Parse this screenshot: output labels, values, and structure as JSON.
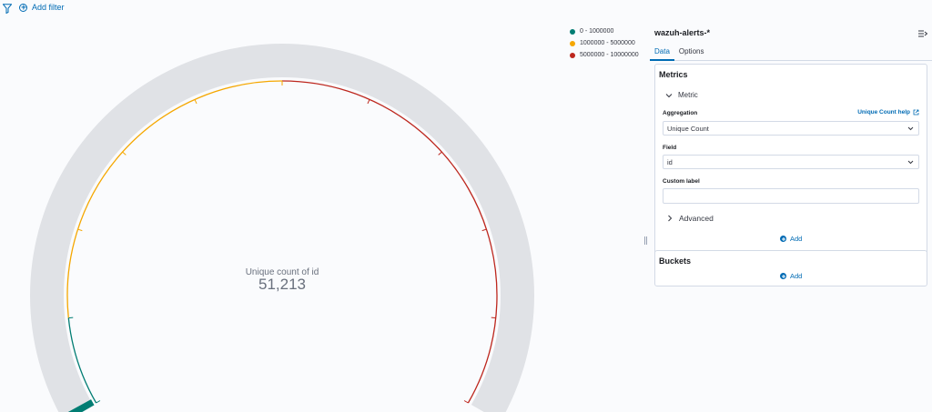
{
  "filter_bar": {
    "add_filter_label": "Add filter",
    "filter_icon": "filter-icon",
    "add_icon": "plus-circle-icon"
  },
  "gauge": {
    "metric_label": "Unique count of id",
    "metric_value": "51,213",
    "value": 51213,
    "range_min": 0,
    "range_max": 10000000,
    "background_color": "#e0e2e6"
  },
  "chart_data": {
    "type": "gauge",
    "series": [
      {
        "name": "Unique count of id",
        "values": [
          51213
        ]
      }
    ],
    "ranges": [
      {
        "label": "0 - 1000000",
        "from": 0,
        "to": 1000000,
        "color": "#017d73"
      },
      {
        "label": "1000000 - 5000000",
        "from": 1000000,
        "to": 5000000,
        "color": "#f5a700"
      },
      {
        "label": "5000000 - 10000000",
        "from": 5000000,
        "to": 10000000,
        "color": "#bd271e"
      }
    ],
    "ylim": [
      0,
      10000000
    ]
  },
  "legend": [
    {
      "label": "0 - 1000000",
      "color": "#017d73"
    },
    {
      "label": "1000000 - 5000000",
      "color": "#f5a700"
    },
    {
      "label": "5000000 - 10000000",
      "color": "#bd271e"
    }
  ],
  "sidebar": {
    "title": "wazuh-alerts-*",
    "collapse_icon": "collapse-panel-icon",
    "tabs": [
      {
        "label": "Data",
        "active": true
      },
      {
        "label": "Options",
        "active": false
      }
    ],
    "metrics": {
      "title": "Metrics",
      "metric_toggle": "Metric",
      "aggregation_label": "Aggregation",
      "aggregation_help": "Unique Count help",
      "aggregation_value": "Unique Count",
      "field_label": "Field",
      "field_value": "id",
      "custom_label_label": "Custom label",
      "custom_label_value": "",
      "advanced_label": "Advanced",
      "add_label": "Add"
    },
    "buckets": {
      "title": "Buckets",
      "add_label": "Add"
    }
  },
  "colors": {
    "accent": "#006bb4"
  }
}
